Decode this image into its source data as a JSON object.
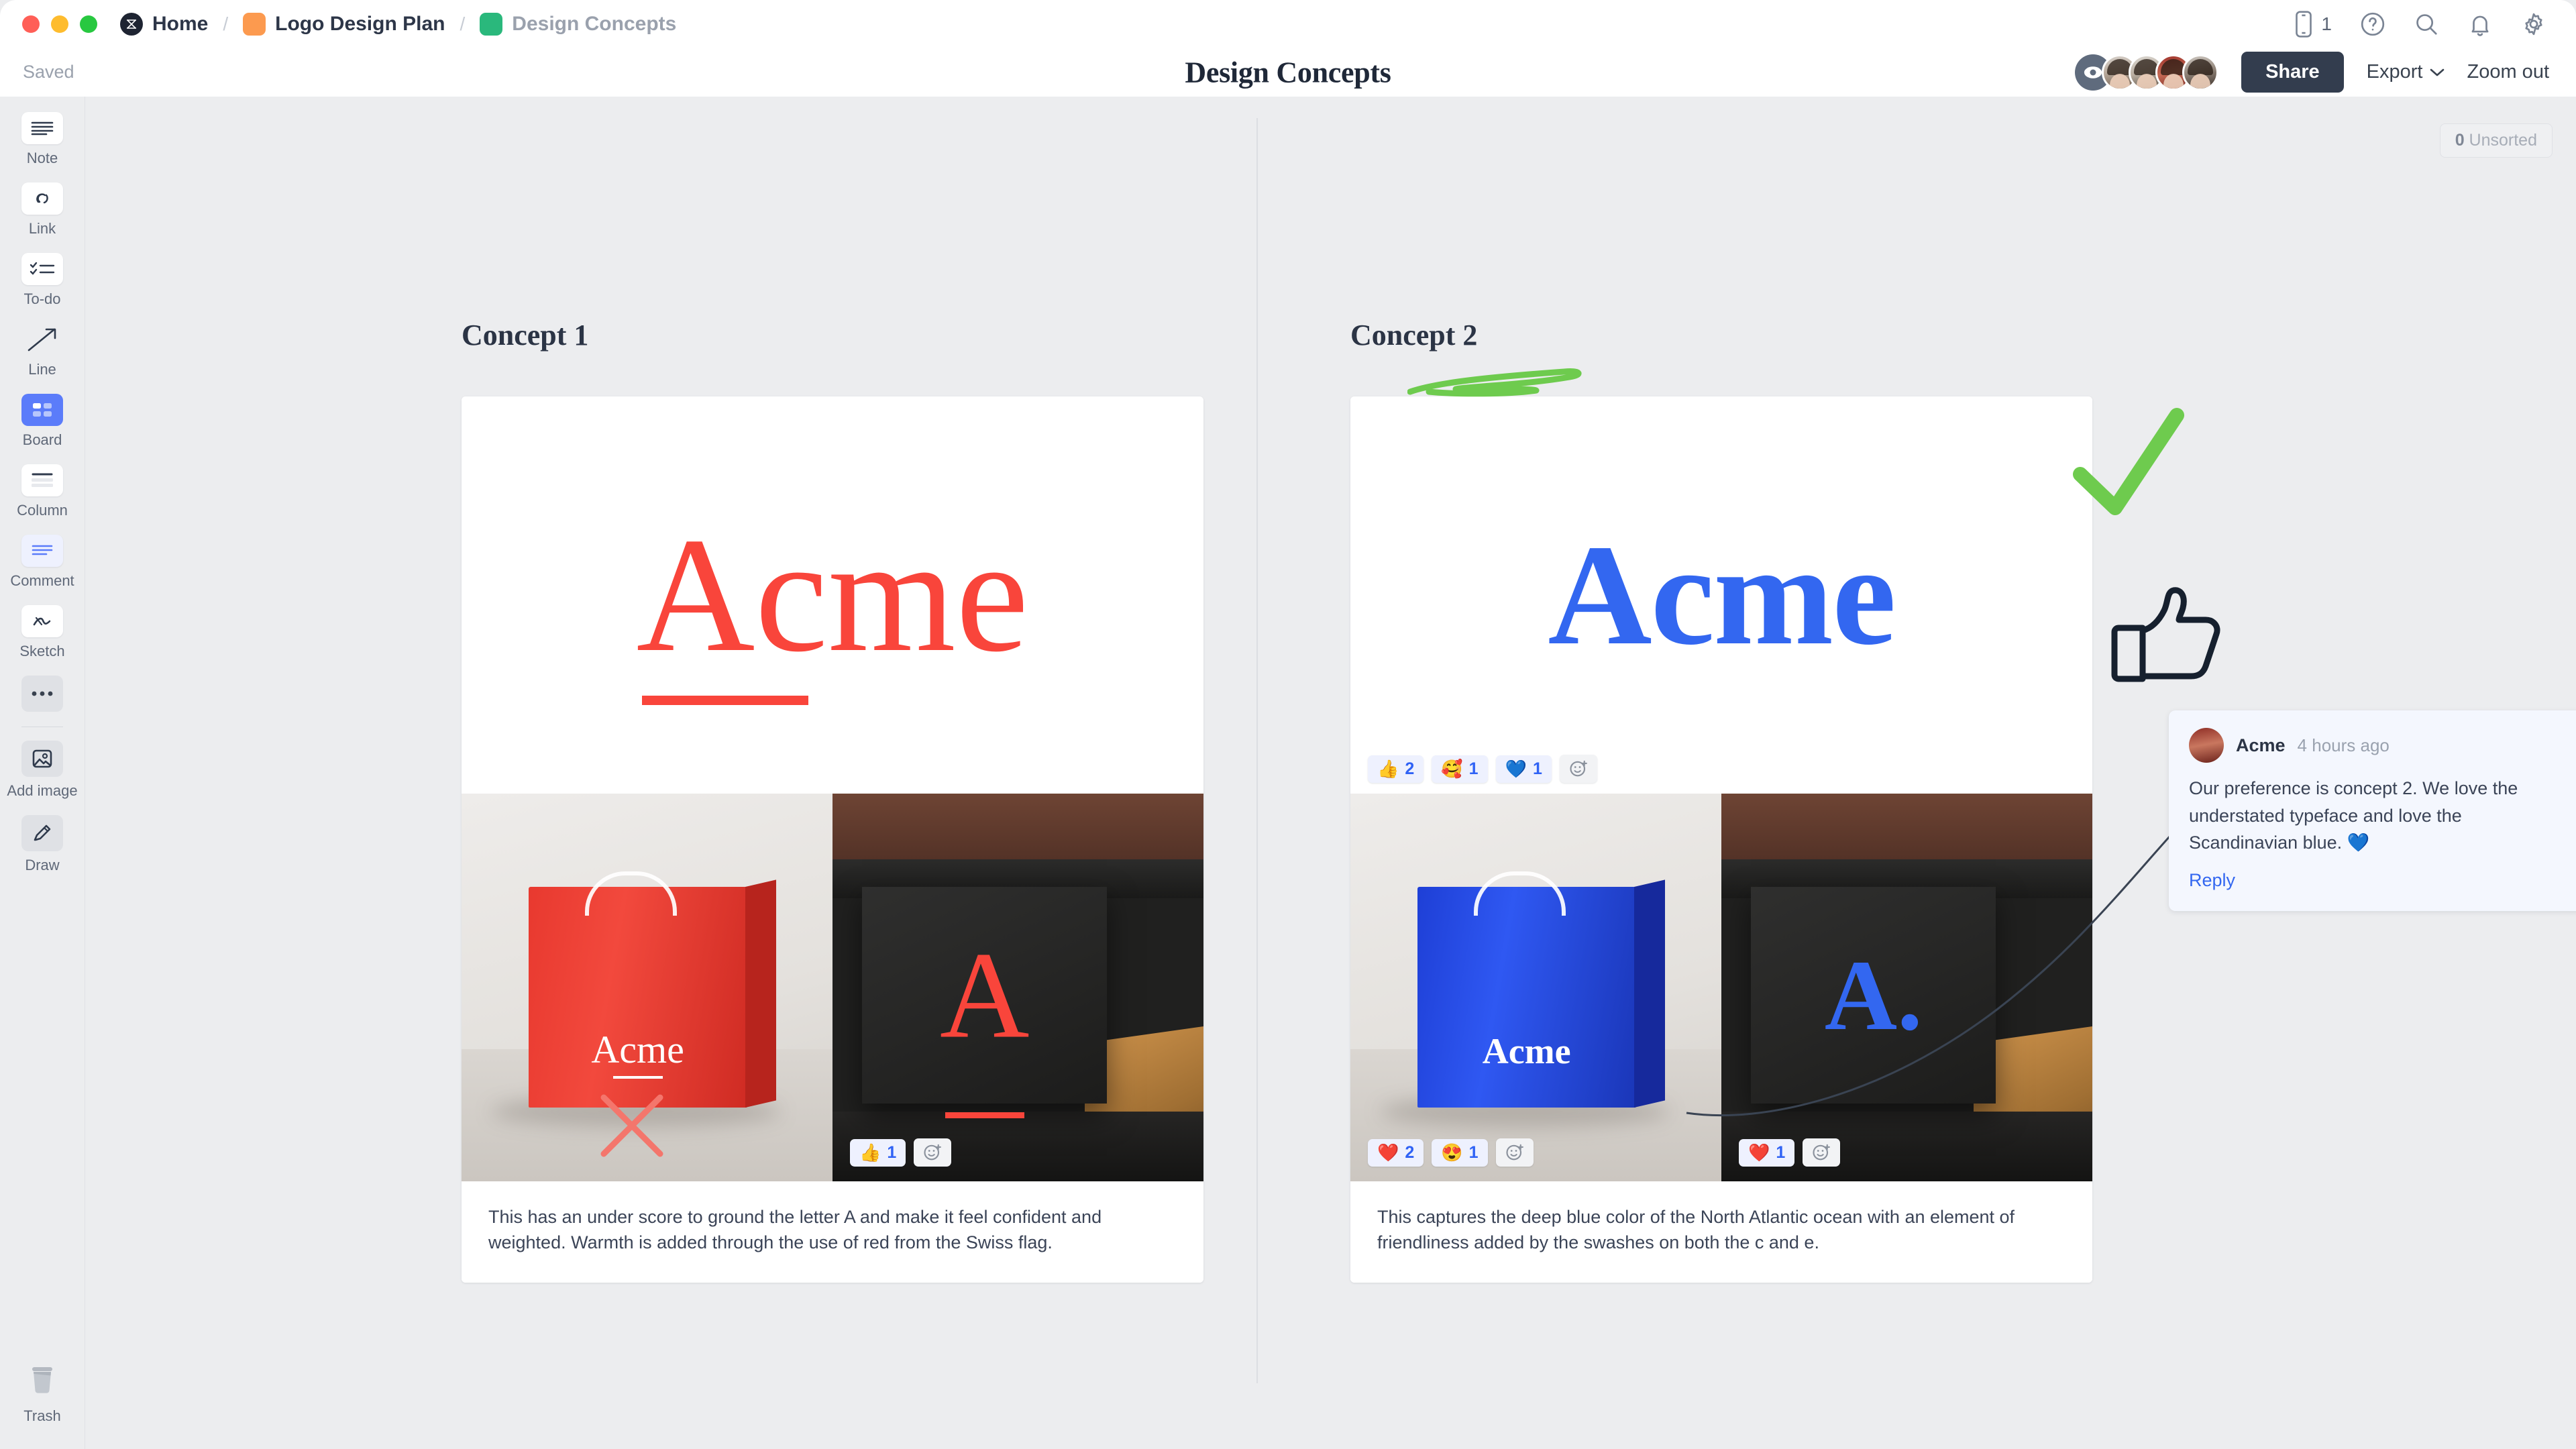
{
  "titlebar": {
    "home_label": "Home",
    "sep": "/",
    "project_label": "Logo Design Plan",
    "page_label": "Design Concepts",
    "mobile_count": "1",
    "icons": [
      "mobile-icon",
      "help-icon",
      "search-icon",
      "bell-icon",
      "gear-icon"
    ]
  },
  "subbar": {
    "saved_label": "Saved",
    "doc_title": "Design Concepts",
    "share_label": "Share",
    "export_label": "Export",
    "zoom_label": "Zoom out"
  },
  "sidebar": {
    "items": [
      {
        "label": "Note",
        "icon": "note-icon"
      },
      {
        "label": "Link",
        "icon": "link-icon"
      },
      {
        "label": "To-do",
        "icon": "todo-icon"
      },
      {
        "label": "Line",
        "icon": "line-icon"
      },
      {
        "label": "Board",
        "icon": "board-icon"
      },
      {
        "label": "Column",
        "icon": "column-icon"
      },
      {
        "label": "Comment",
        "icon": "comment-icon"
      },
      {
        "label": "Sketch",
        "icon": "sketch-icon"
      }
    ],
    "more_label": "",
    "add_image": {
      "label": "Add image",
      "icon": "add-image-icon"
    },
    "draw": {
      "label": "Draw",
      "icon": "pencil-icon"
    },
    "trash": {
      "label": "Trash",
      "icon": "trash-icon"
    }
  },
  "canvas": {
    "unsorted_count": "0",
    "unsorted_label": "Unsorted"
  },
  "concepts": [
    {
      "title": "Concept 1",
      "logo_word": "Acme",
      "logo_color": "#f9453b",
      "bag_word": "Acme",
      "store_letter": "A",
      "caption": "This has an under score to ground the letter A and make it feel confident and weighted. Warmth is added through the use of red from the Swiss flag.",
      "logo_reactions": [],
      "bag_reactions": [],
      "store_reactions": [
        {
          "emoji": "👍",
          "count": "1",
          "name": "thumbs-up"
        }
      ],
      "annotation": "x-mark"
    },
    {
      "title": "Concept 2",
      "logo_word": "Acme",
      "logo_color": "#3367f0",
      "bag_word": "Acme",
      "store_letter": "A.",
      "caption": "This captures the deep blue color of the North Atlantic ocean with an element of friendliness added by the swashes on both the c and e.",
      "logo_reactions": [
        {
          "emoji": "👍",
          "count": "2",
          "name": "thumbs-up"
        },
        {
          "emoji": "🥰",
          "count": "1",
          "name": "smiling-face-with-hearts"
        },
        {
          "emoji": "💙",
          "count": "1",
          "name": "blue-heart"
        }
      ],
      "bag_reactions": [
        {
          "emoji": "❤️",
          "count": "2",
          "name": "red-heart"
        },
        {
          "emoji": "😍",
          "count": "1",
          "name": "heart-eyes"
        }
      ],
      "store_reactions": [
        {
          "emoji": "❤️",
          "count": "1",
          "name": "red-heart"
        }
      ],
      "annotation": "check-mark"
    }
  ],
  "comment": {
    "author": "Acme",
    "time": "4 hours ago",
    "body": "Our preference is concept 2. We love the understated typeface and love the Scandinavian blue. 💙",
    "reply_label": "Reply"
  },
  "colors": {
    "accent_blue": "#3367f0",
    "concept1_red": "#f9453b",
    "annotation_green": "#6ecb4e",
    "share_dark": "#333d4e",
    "canvas_bg": "#ecedef"
  }
}
